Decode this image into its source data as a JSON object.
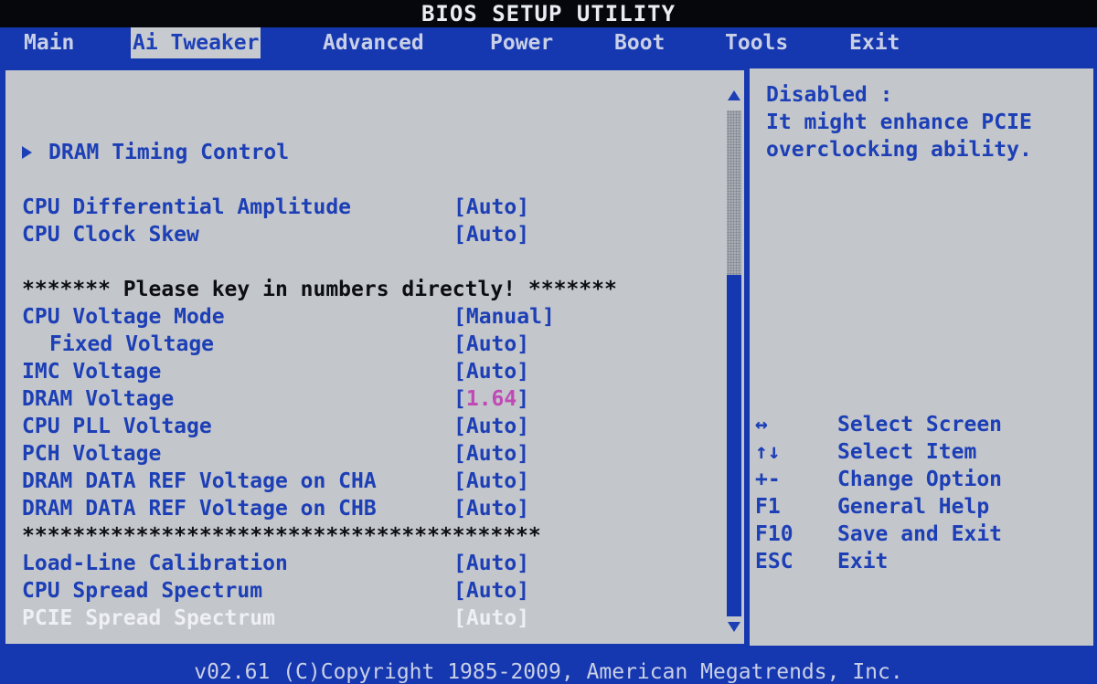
{
  "title": "BIOS SETUP UTILITY",
  "menu": {
    "tabs": [
      {
        "label": "Main"
      },
      {
        "label": "Ai Tweaker"
      },
      {
        "label": "Advanced"
      },
      {
        "label": "Power"
      },
      {
        "label": "Boot"
      },
      {
        "label": "Tools"
      },
      {
        "label": "Exit"
      }
    ],
    "active_tab": "Ai Tweaker"
  },
  "settings": {
    "submenu": "DRAM Timing Control",
    "items": [
      {
        "label": "CPU Differential Amplitude",
        "value": "Auto"
      },
      {
        "label": "CPU Clock Skew",
        "value": "Auto"
      },
      {
        "label": "******* Please key in numbers directly! *******"
      },
      {
        "label": "CPU Voltage Mode",
        "value": "Manual"
      },
      {
        "label": "Fixed Voltage",
        "value": "Auto"
      },
      {
        "label": "IMC Voltage",
        "value": "Auto"
      },
      {
        "label": "DRAM Voltage",
        "value": "1.64"
      },
      {
        "label": "CPU PLL Voltage",
        "value": "Auto"
      },
      {
        "label": "PCH Voltage",
        "value": "Auto"
      },
      {
        "label": "DRAM DATA REF Voltage on CHA",
        "value": "Auto"
      },
      {
        "label": "DRAM DATA REF Voltage on CHB",
        "value": "Auto"
      },
      {
        "label": "*****************************************"
      },
      {
        "label": "Load-Line Calibration",
        "value": "Auto"
      },
      {
        "label": "CPU Spread Spectrum",
        "value": "Auto"
      },
      {
        "label": "PCIE Spread Spectrum",
        "value": "Auto"
      }
    ],
    "selected": "PCIE Spread Spectrum"
  },
  "help": {
    "lines": [
      "Disabled :",
      "It might enhance PCIE",
      "overclocking ability."
    ]
  },
  "keys": [
    {
      "key": "↔",
      "desc": "Select Screen"
    },
    {
      "key": "↑↓",
      "desc": "Select Item"
    },
    {
      "key": "+-",
      "desc": "Change Option"
    },
    {
      "key": "F1",
      "desc": "General Help"
    },
    {
      "key": "F10",
      "desc": "Save and Exit"
    },
    {
      "key": "ESC",
      "desc": "Exit"
    }
  ],
  "footer": "v02.61 (C)Copyright 1985-2009, American Megatrends, Inc.",
  "colors": {
    "accent": "#1537b0",
    "panel": "#c3c6cb",
    "text": "#1d3fb6",
    "highlight_value": "#c04ab5",
    "selected_text": "#eef0f3"
  }
}
